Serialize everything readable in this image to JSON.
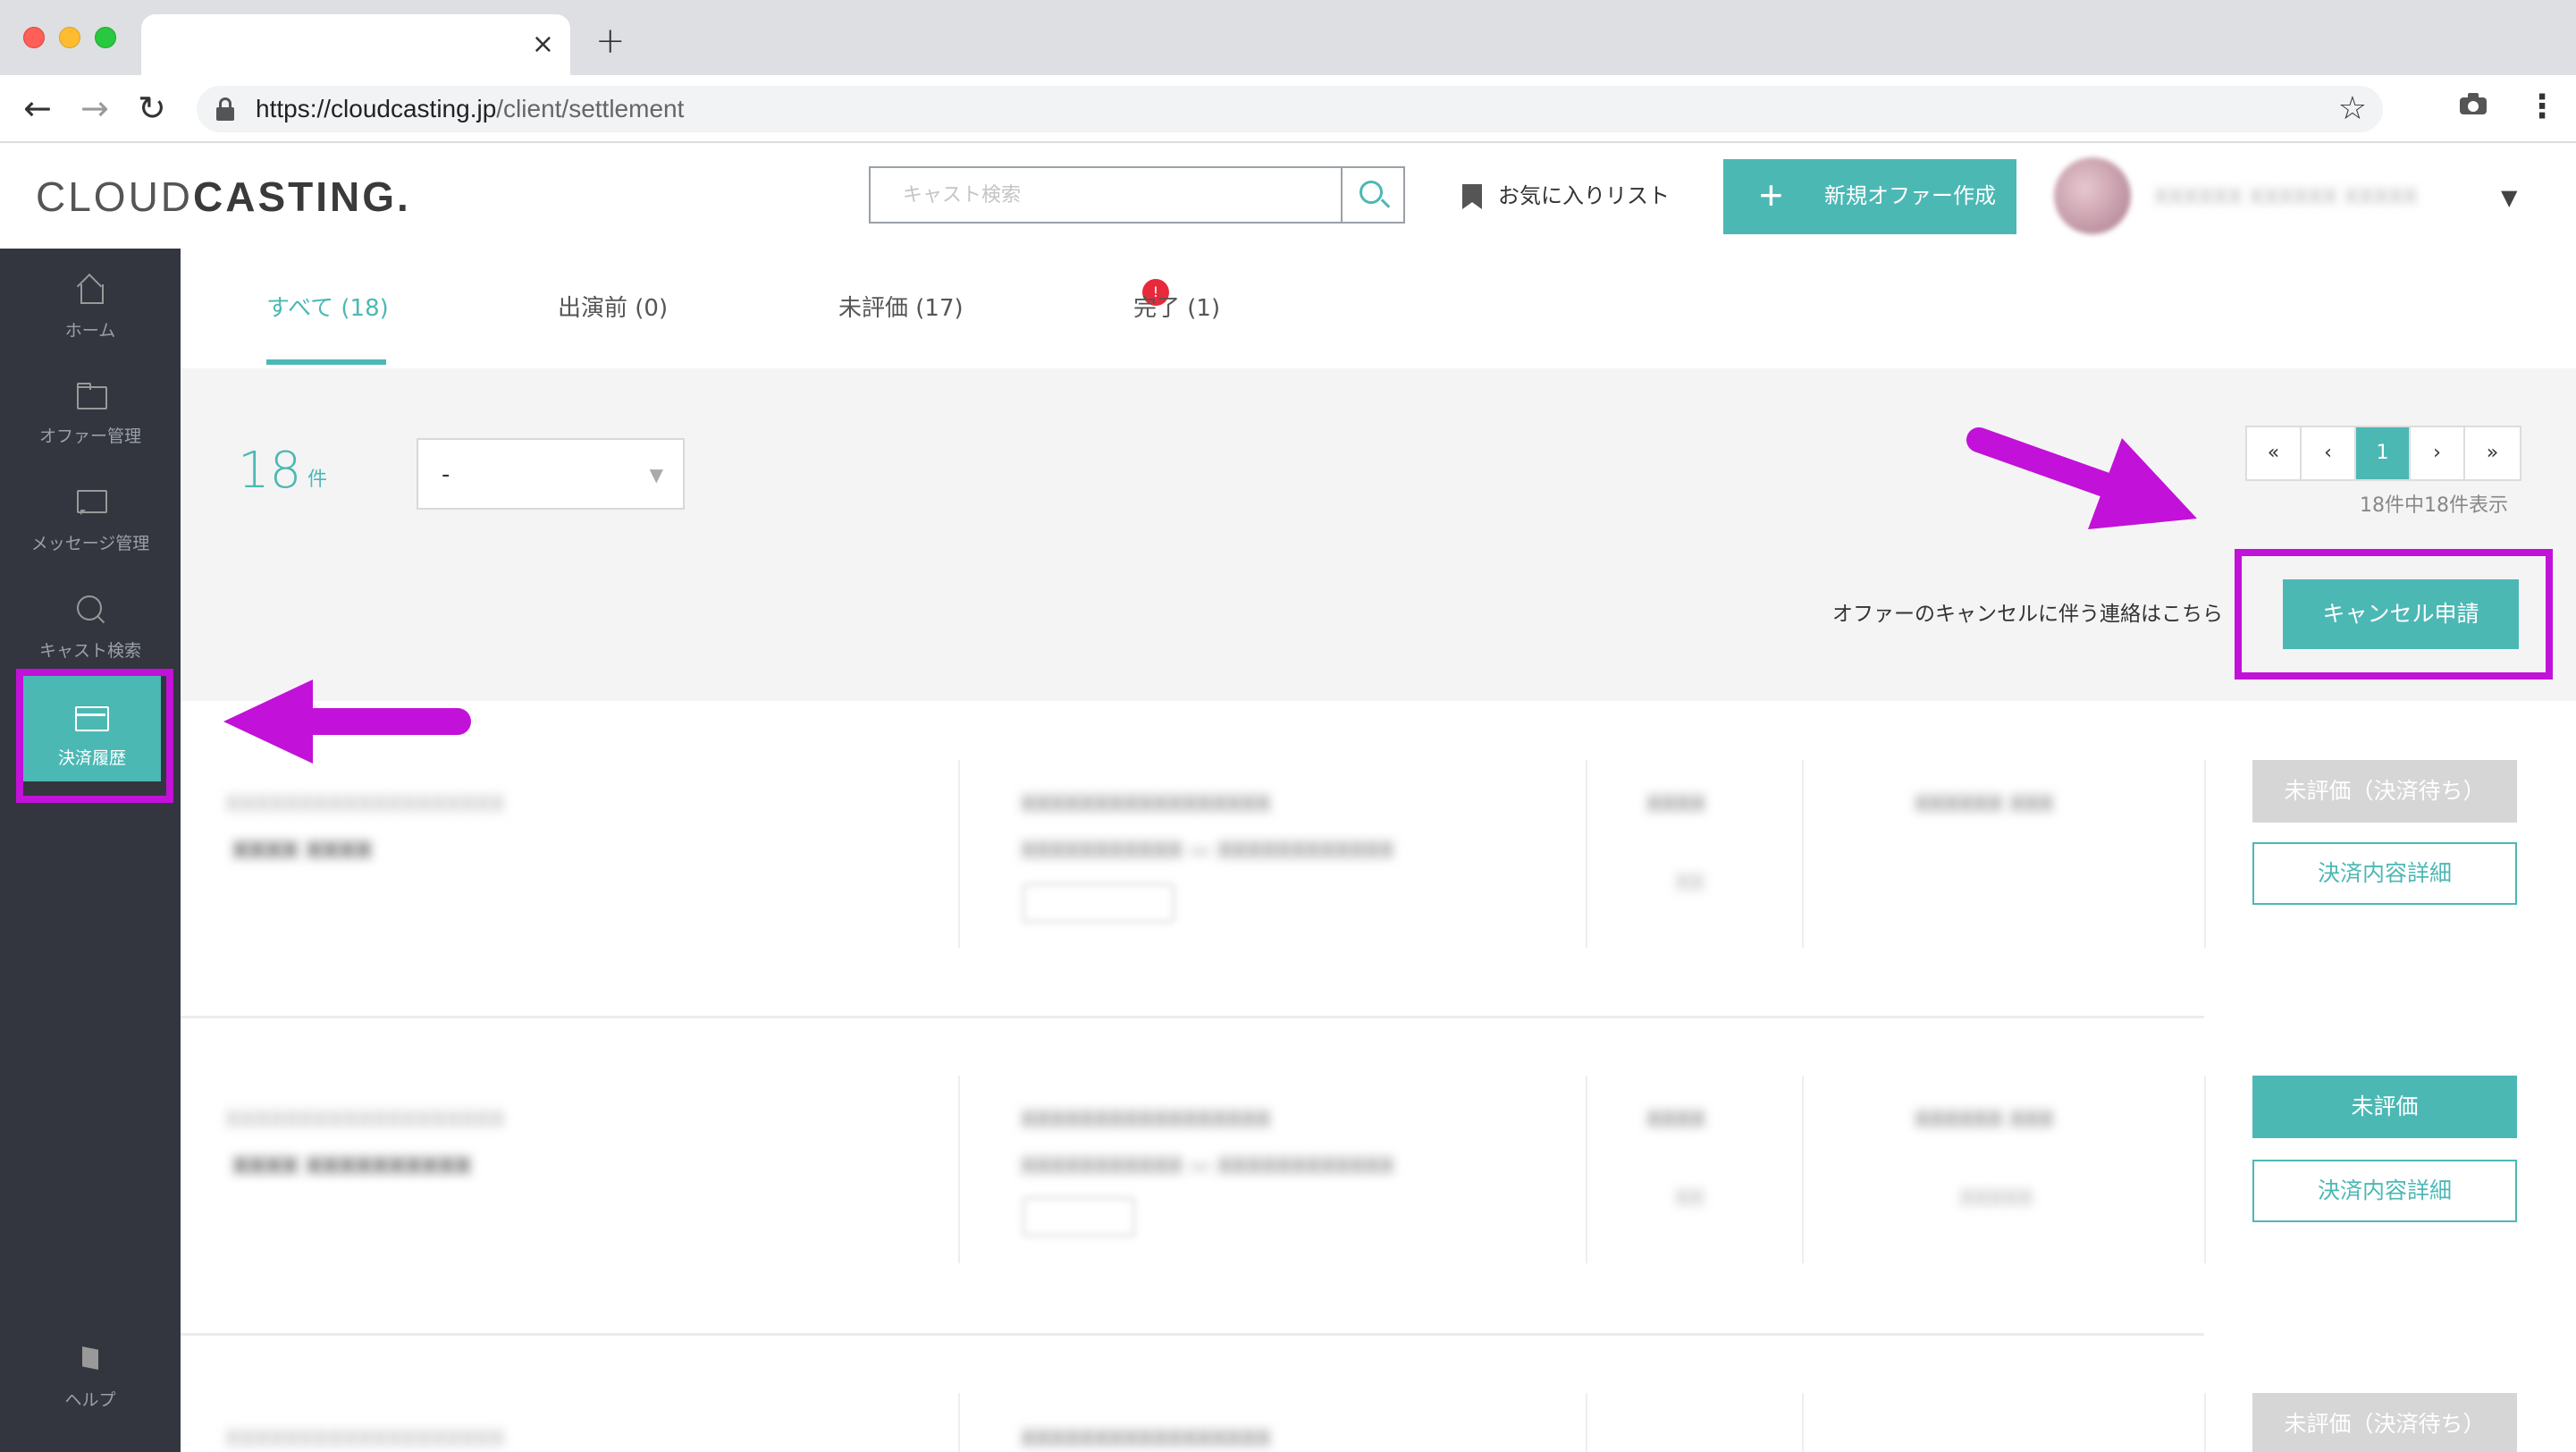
{
  "browser": {
    "tab_close": "×",
    "new_tab": "+",
    "url_host": "https://cloudcasting.jp",
    "url_path": "/client/settlement"
  },
  "header": {
    "logo_light": "CLOUD",
    "logo_bold": "CASTING.",
    "search_placeholder": "キャスト検索",
    "favorites_label": "お気に入りリスト",
    "new_offer_label": "新規オファー作成"
  },
  "sidebar": {
    "items": [
      {
        "label": "ホーム",
        "icon": "home-icon"
      },
      {
        "label": "オファー管理",
        "icon": "folder-icon"
      },
      {
        "label": "メッセージ管理",
        "icon": "message-icon"
      },
      {
        "label": "キャスト検索",
        "icon": "search-icon"
      },
      {
        "label": "決済履歴",
        "icon": "credit-card-icon"
      }
    ],
    "help_label": "ヘルプ"
  },
  "tabs": [
    {
      "label": "すべて (18)",
      "active": true
    },
    {
      "label": "出演前 (0)",
      "active": false
    },
    {
      "label": "未評価 (17)",
      "active": false,
      "badge": "!"
    },
    {
      "label": "完了 (1)",
      "active": false
    }
  ],
  "summary": {
    "count": "18",
    "unit": "件",
    "select_value": "-"
  },
  "pagination": {
    "first": "«",
    "prev": "‹",
    "current": "1",
    "next": "›",
    "last": "»",
    "note": "18件中18件表示"
  },
  "cancel": {
    "note": "オファーのキャンセルに伴う連絡はこちら",
    "button": "キャンセル申請"
  },
  "rows": [
    {
      "status_button": "未評価（決済待ち）",
      "detail_button": "決済内容詳細"
    },
    {
      "status_button": "未評価",
      "detail_button": "決済内容詳細"
    },
    {
      "status_button": "未評価（決済待ち）"
    }
  ],
  "colors": {
    "accent": "#4cb8b4",
    "sidebar_bg": "#33363f",
    "annotation": "#c211d8",
    "badge": "#e8293b"
  }
}
